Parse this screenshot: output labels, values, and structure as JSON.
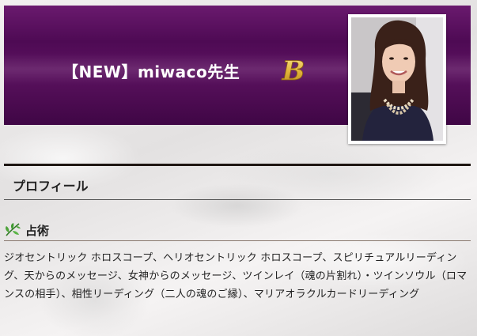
{
  "header": {
    "title": "【NEW】miwaco先生",
    "badge_letter": "B",
    "colors": {
      "header_purple": "#5a0f5e",
      "badge_gold": "#e2b53b"
    }
  },
  "profile": {
    "heading": "プロフィール"
  },
  "fortune": {
    "icon": "leaf-icon",
    "label": "占術",
    "text": "ジオセントリック ホロスコープ、ヘリオセントリック ホロスコープ、スピリチュアルリーディング、天からのメッセージ、女神からのメッセージ、ツインレイ（魂の片割れ）・ツインソウル（ロマンスの相手）、相性リーディング（二人の魂のご縁）、マリアオラクルカードリーディング"
  }
}
